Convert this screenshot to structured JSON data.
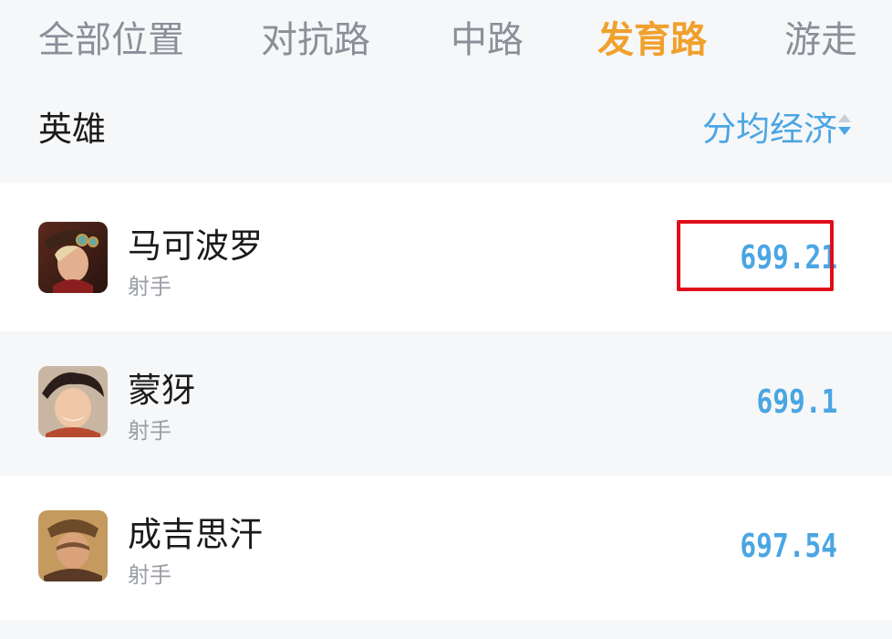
{
  "tabs": [
    {
      "label": "全部位置",
      "active": false
    },
    {
      "label": "对抗路",
      "active": false
    },
    {
      "label": "中路",
      "active": false
    },
    {
      "label": "发育路",
      "active": true
    },
    {
      "label": "游走",
      "active": false
    }
  ],
  "header": {
    "hero_label": "英雄",
    "sort_label": "分均经济"
  },
  "heroes": [
    {
      "name": "马可波罗",
      "role": "射手",
      "value": "699.21",
      "highlighted": true,
      "avatar_icon": "marco-polo-portrait-icon"
    },
    {
      "name": "蒙犽",
      "role": "射手",
      "value": "699.1",
      "highlighted": false,
      "avatar_icon": "mengya-portrait-icon"
    },
    {
      "name": "成吉思汗",
      "role": "射手",
      "value": "697.54",
      "highlighted": false,
      "avatar_icon": "genghis-khan-portrait-icon"
    }
  ],
  "colors": {
    "active_tab": "#f0a02c",
    "inactive_tab": "#8a8f98",
    "accent_blue": "#4aa6e3",
    "highlight_red": "#e00d1a"
  }
}
